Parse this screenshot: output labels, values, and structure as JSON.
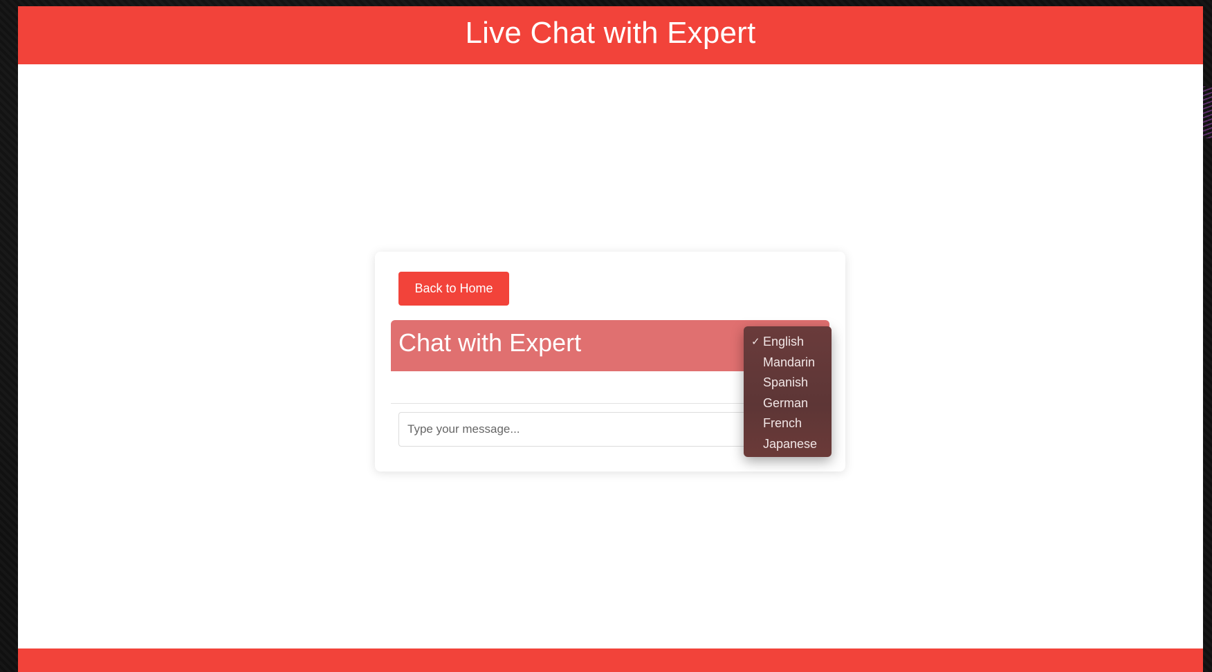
{
  "header": {
    "title": "Live Chat with Expert"
  },
  "card": {
    "back_button_label": "Back to Home",
    "chat_title": "Chat with Expert",
    "message_placeholder": "Type your message..."
  },
  "language_menu": {
    "selected": "English",
    "check_glyph": "✓",
    "options": [
      "English",
      "Mandarin",
      "Spanish",
      "German",
      "French",
      "Japanese"
    ]
  },
  "colors": {
    "brand_red": "#f2433a",
    "chat_header": "#e07070",
    "menu_bg": "#5d3636"
  }
}
